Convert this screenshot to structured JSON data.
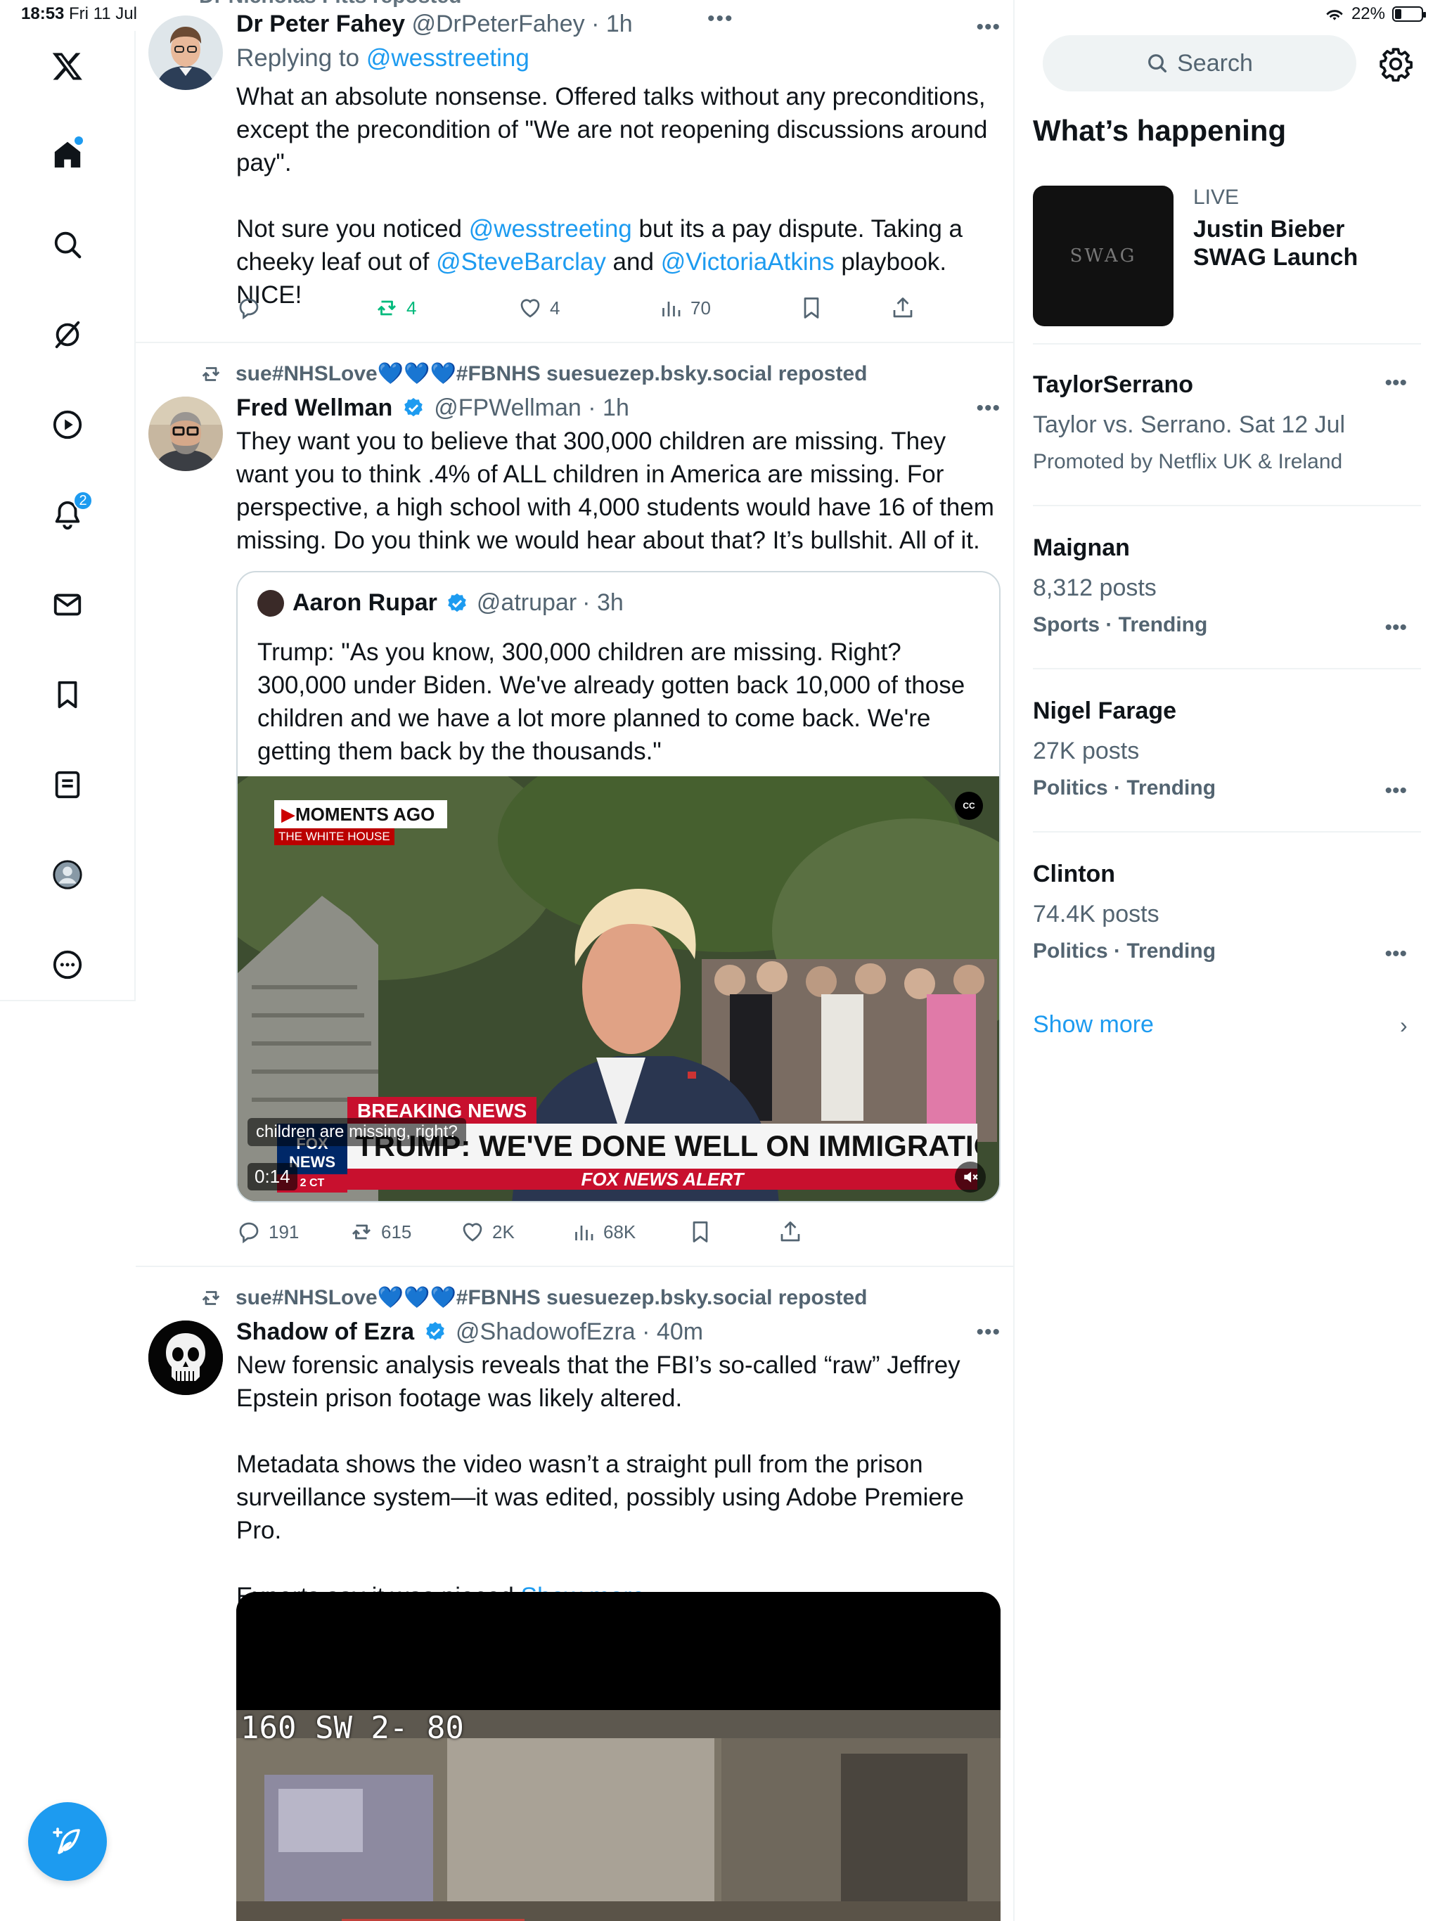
{
  "status": {
    "time": "18:53",
    "date": "Fri 11 Jul",
    "battery": "22%"
  },
  "nav": {
    "notifications_count": "2"
  },
  "tweets": [
    {
      "header_partial": "Dr Nicholas Fitts reposted",
      "name": "Dr Peter Fahey",
      "handle": "@DrPeterFahey",
      "time": "· 1h",
      "replying_prefix": "Replying to ",
      "replying_to": "@wesstreeting",
      "p1": "What an absolute nonsense. Offered talks without any preconditions, except the precondition of \"We are not reopening discussions around pay\".",
      "p2a": "Not sure you noticed ",
      "p2_link1": "@wesstreeting",
      "p2b": " but its a pay dispute. Taking a cheeky leaf out of ",
      "p2_link2": "@SteveBarclay",
      "p2c": " and ",
      "p2_link3": "@VictoriaAtkins",
      "p2d": " playbook. NICE!",
      "replies": "",
      "reposts": "4",
      "likes": "4",
      "views": "70"
    },
    {
      "repost_by": "sue#NHSLove💙💙💙#FBNHS suesuezep.bsky.social reposted",
      "name": "Fred Wellman",
      "handle": "@FPWellman",
      "time": "· 1h",
      "text": "They want you to believe that 300,000 children are missing. They want you to think .4% of ALL children in America are missing. For perspective, a high school with 4,000 students would have 16 of them missing. Do you think we would hear about that? It’s bullshit. All of it.",
      "quote": {
        "name": "Aaron Rupar",
        "handle": "@atrupar",
        "time": "· 3h",
        "text": "Trump: \"As you know, 300,000 children are missing. Right? 300,000 under Biden. We've already gotten back 10,000 of those children and we have a lot more planned to come back. We're getting them back by the thousands.\"",
        "video": {
          "moments_ago": "MOMENTS AGO",
          "white_house": "THE WHITE HOUSE",
          "breaking": "BREAKING NEWS",
          "headline": "TRUMP: WE'VE DONE WELL ON IMMIGRATION",
          "alert": "FOX NEWS ALERT",
          "fox": "FOX NEWS",
          "clock": "2 CT",
          "caption": "children are missing, right?",
          "duration": "0:14",
          "cc": "CC"
        }
      },
      "replies": "191",
      "reposts": "615",
      "likes": "2K",
      "views": "68K"
    },
    {
      "repost_by": "sue#NHSLove💙💙💙#FBNHS suesuezep.bsky.social reposted",
      "name": "Shadow of Ezra",
      "handle": "@ShadowofEzra",
      "time": "· 40m",
      "p1": "New forensic analysis reveals that the FBI’s so-called “raw” Jeffrey Epstein prison footage was likely altered.",
      "p2": "Metadata shows the video wasn’t a straight pull from the prison surveillance system—it was edited, possibly using Adobe Premiere Pro.",
      "p3": "Experts say it was pieced ",
      "show_more": "Show more",
      "video_overlay": "160 SW 2- 80"
    }
  ],
  "sidebar": {
    "search_placeholder": "Search",
    "title": "What’s happening",
    "live": {
      "label": "LIVE",
      "title": "Justin Bieber SWAG Launch",
      "thumb_text": "SWAG"
    },
    "trends": [
      {
        "name": "TaylorSerrano",
        "sub": "Taylor vs. Serrano. Sat 12 Jul",
        "meta": "Promoted by Netflix UK & Ireland"
      },
      {
        "name": "Maignan",
        "sub": "8,312 posts",
        "meta": "Sports · Trending"
      },
      {
        "name": "Nigel Farage",
        "sub": "27K posts",
        "meta": "Politics · Trending"
      },
      {
        "name": "Clinton",
        "sub": "74.4K posts",
        "meta": "Politics · Trending"
      }
    ],
    "show_more": "Show more"
  },
  "colors": {
    "accent": "#1d9bf0",
    "repost_green": "#00ba7c",
    "muted": "#536471"
  }
}
